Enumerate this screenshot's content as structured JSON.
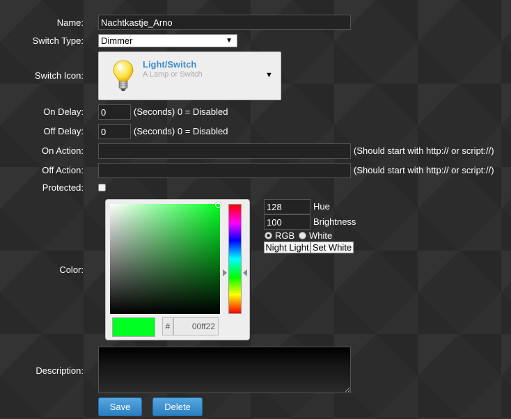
{
  "form": {
    "name": {
      "label": "Name:",
      "value": "Nachtkastje_Arno"
    },
    "switch_type": {
      "label": "Switch Type:",
      "value": "Dimmer",
      "arrow": "▼"
    },
    "switch_icon": {
      "label": "Switch Icon:",
      "title": "Light/Switch",
      "subtitle": "A Lamp or Switch",
      "icon": "lightbulb-icon",
      "arrow": "▼"
    },
    "on_delay": {
      "label": "On Delay:",
      "value": "0",
      "note": "(Seconds) 0 = Disabled"
    },
    "off_delay": {
      "label": "Off Delay:",
      "value": "0",
      "note": "(Seconds) 0 = Disabled"
    },
    "on_action": {
      "label": "On Action:",
      "value": "",
      "note": "(Should start with http:// or script://)"
    },
    "off_action": {
      "label": "Off Action:",
      "value": "",
      "note": "(Should start with http:// or script://)"
    },
    "protected": {
      "label": "Protected:",
      "checked": false
    },
    "color": {
      "label": "Color:",
      "hex_prefix": "#",
      "hex_value": "00ff22",
      "current_color": "#00ff22",
      "hue": {
        "value": "128",
        "label": "Hue"
      },
      "brightness": {
        "value": "100",
        "label": "Brightness"
      },
      "modes": {
        "rgb": "RGB",
        "white": "White",
        "selected": "RGB"
      },
      "night_light_label": "Night Light",
      "set_white_label": "Set White"
    },
    "description": {
      "label": "Description:",
      "value": ""
    }
  },
  "buttons": {
    "save": "Save",
    "delete": "Delete",
    "color": "#3a8fd0"
  }
}
